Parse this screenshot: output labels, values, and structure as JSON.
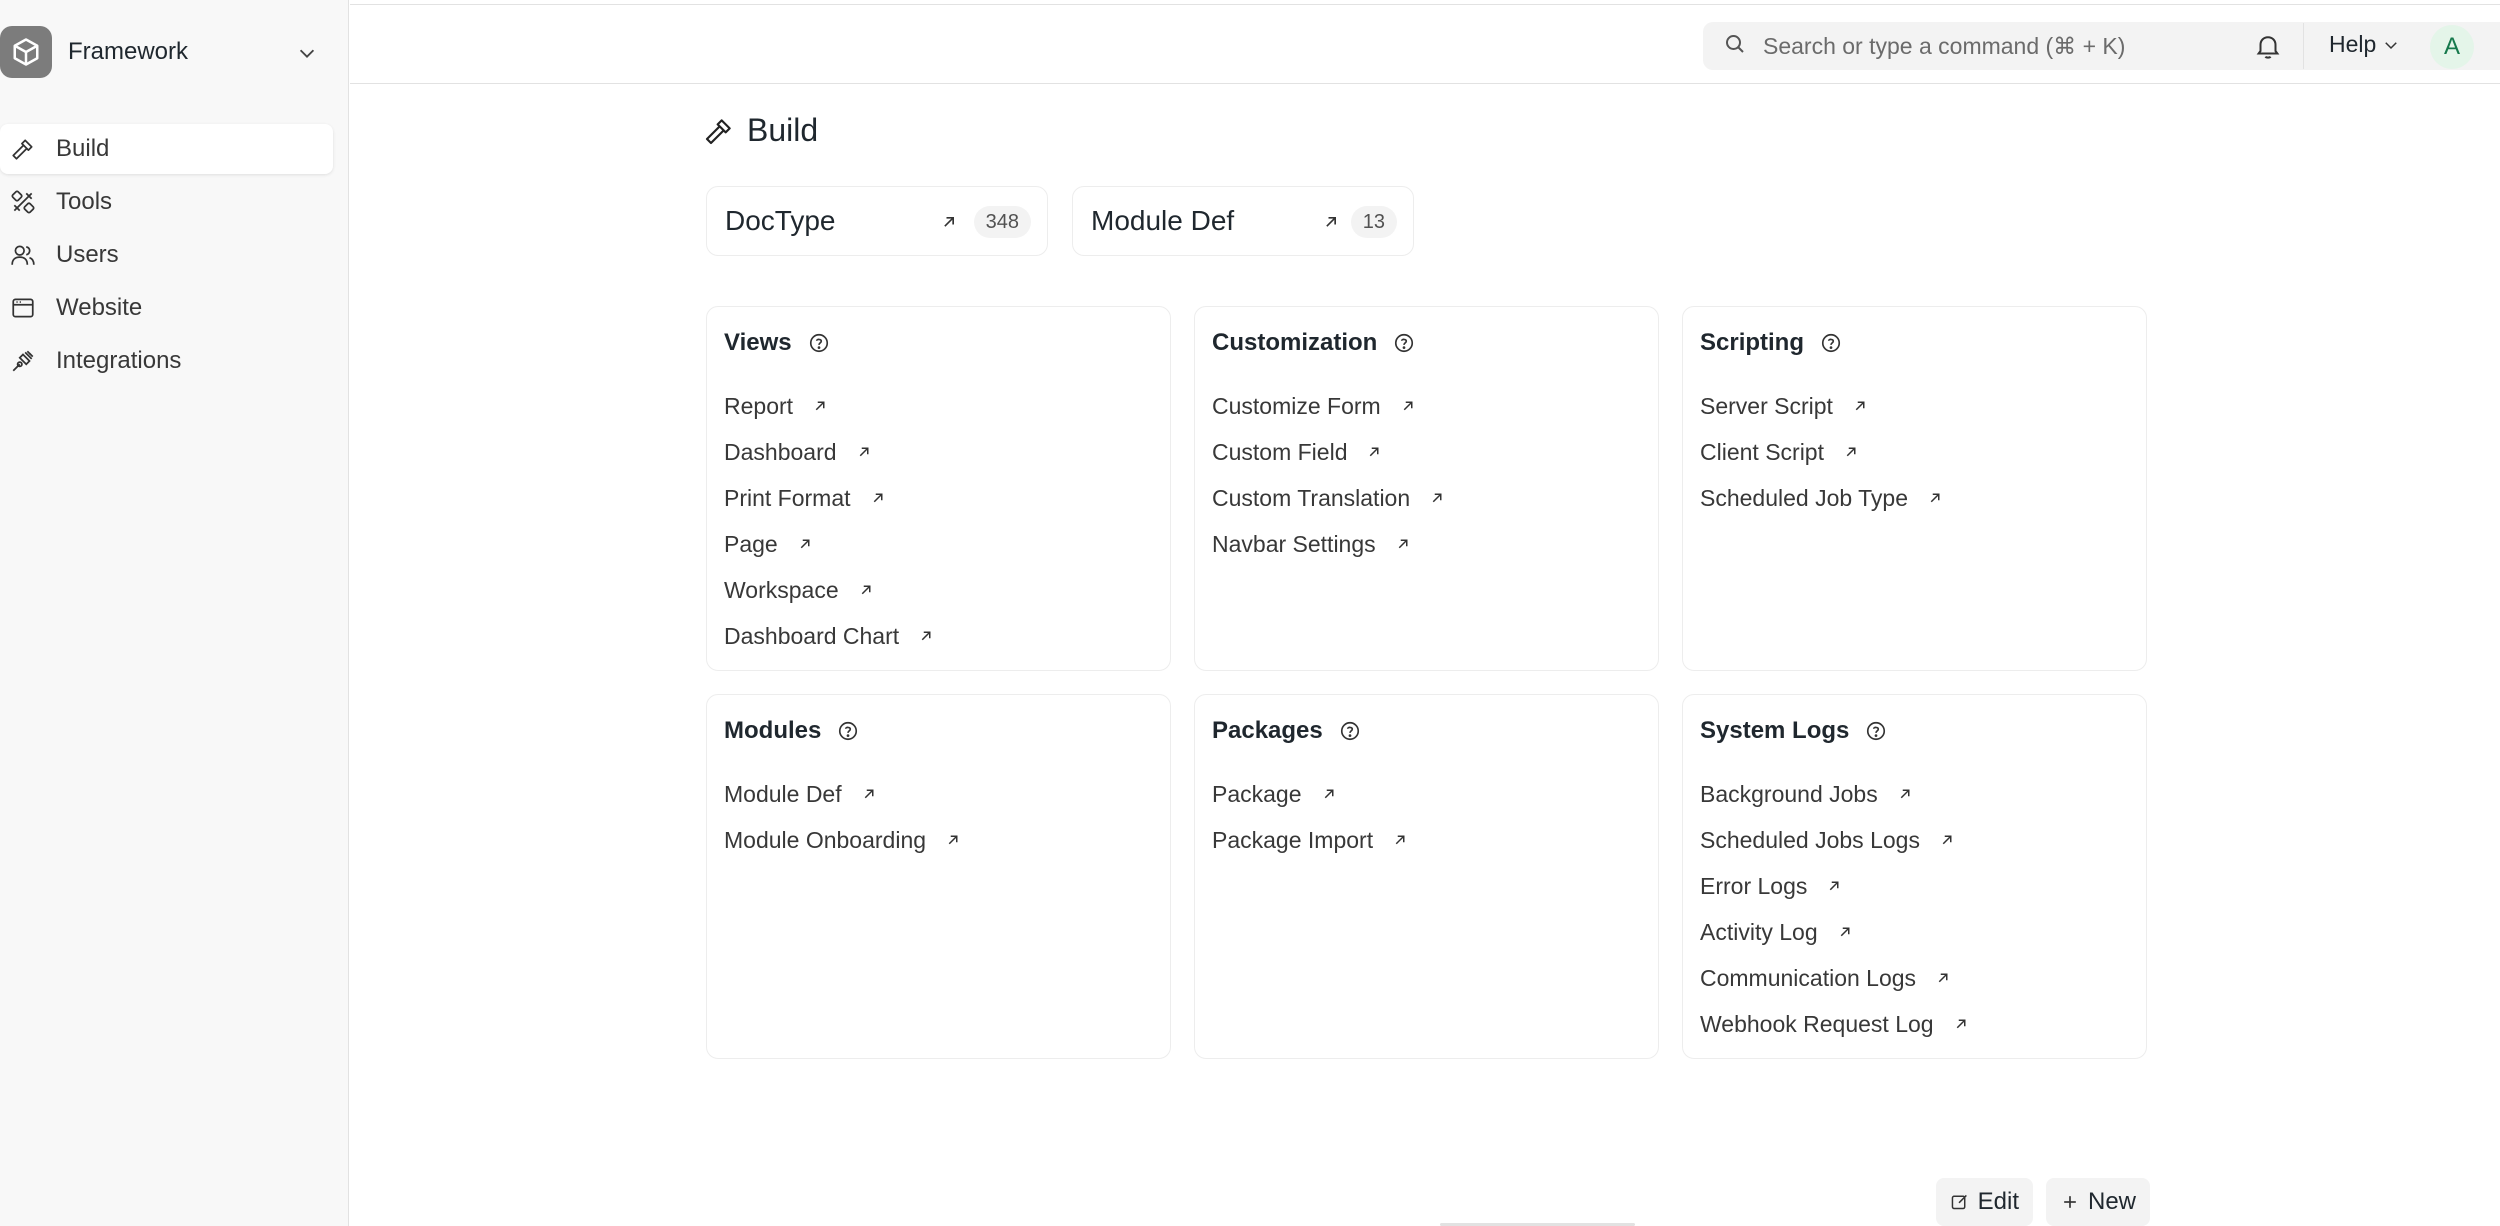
{
  "workspace_switcher": {
    "name": "Framework"
  },
  "sidebar": {
    "items": [
      {
        "label": "Build",
        "icon": "hammer-icon",
        "active": true
      },
      {
        "label": "Tools",
        "icon": "tools-icon"
      },
      {
        "label": "Users",
        "icon": "users-icon"
      },
      {
        "label": "Website",
        "icon": "browser-window-icon"
      },
      {
        "label": "Integrations",
        "icon": "plug-icon"
      }
    ]
  },
  "topbar": {
    "search_placeholder": "Search or type a command (⌘ + K)",
    "help_label": "Help",
    "avatar_initial": "A"
  },
  "page": {
    "title": "Build"
  },
  "shortcuts": [
    {
      "label": "DocType",
      "count": "348"
    },
    {
      "label": "Module Def",
      "count": "13"
    }
  ],
  "cards": [
    {
      "title": "Views",
      "links": [
        "Report",
        "Dashboard",
        "Print Format",
        "Page",
        "Workspace",
        "Dashboard Chart"
      ]
    },
    {
      "title": "Customization",
      "links": [
        "Customize Form",
        "Custom Field",
        "Custom Translation",
        "Navbar Settings"
      ]
    },
    {
      "title": "Scripting",
      "links": [
        "Server Script",
        "Client Script",
        "Scheduled Job Type"
      ]
    },
    {
      "title": "Modules",
      "links": [
        "Module Def",
        "Module Onboarding"
      ]
    },
    {
      "title": "Packages",
      "links": [
        "Package",
        "Package Import"
      ]
    },
    {
      "title": "System Logs",
      "links": [
        "Background Jobs",
        "Scheduled Jobs Logs",
        "Error Logs",
        "Activity Log",
        "Communication Logs",
        "Webhook Request Log"
      ]
    }
  ],
  "actions": {
    "edit_label": "Edit",
    "new_label": "New"
  },
  "colors": {
    "accent_avatar_bg": "#e4f5e9",
    "accent_avatar_fg": "#16794c",
    "logo_bg": "#7c7c7c"
  }
}
